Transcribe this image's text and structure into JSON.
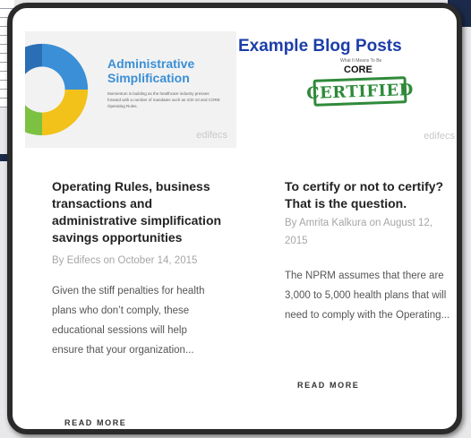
{
  "header": {
    "title": "Example Blog Posts"
  },
  "posts": [
    {
      "thumbnail": {
        "title_line1": "Administrative",
        "title_line2": "Simplification",
        "body": "Momentum is building as the healthcare industry presses forward with a number of mandates such as ICD-10 and CORE Operating Rules.",
        "logo": "edifecs"
      },
      "title": "Operating Rules, business transactions and administrative simplification savings opportunities",
      "meta": "By Edifecs on October 14, 2015",
      "excerpt": "Given the stiff penalties for health plans who don’t comply, these educational sessions will help ensure that your organization...",
      "read_more": "READ MORE"
    },
    {
      "thumbnail": {
        "caption": "What It Means To Be",
        "core": "CORE",
        "stamp": "CERTIFIED",
        "logo": "edifecs"
      },
      "title": "To certify or not to certify? That is the question.",
      "meta": "By Amrita Kalkura on August 12, 2015",
      "excerpt": "The NPRM assumes that there are 3,000 to 5,000 health plans that will need to comply with the Operating...",
      "read_more": "READ MORE"
    }
  ],
  "colors": {
    "headline": "#1c3ea8",
    "accent_blue": "#3a8fd6",
    "stamp_green": "#2f8a3a"
  }
}
